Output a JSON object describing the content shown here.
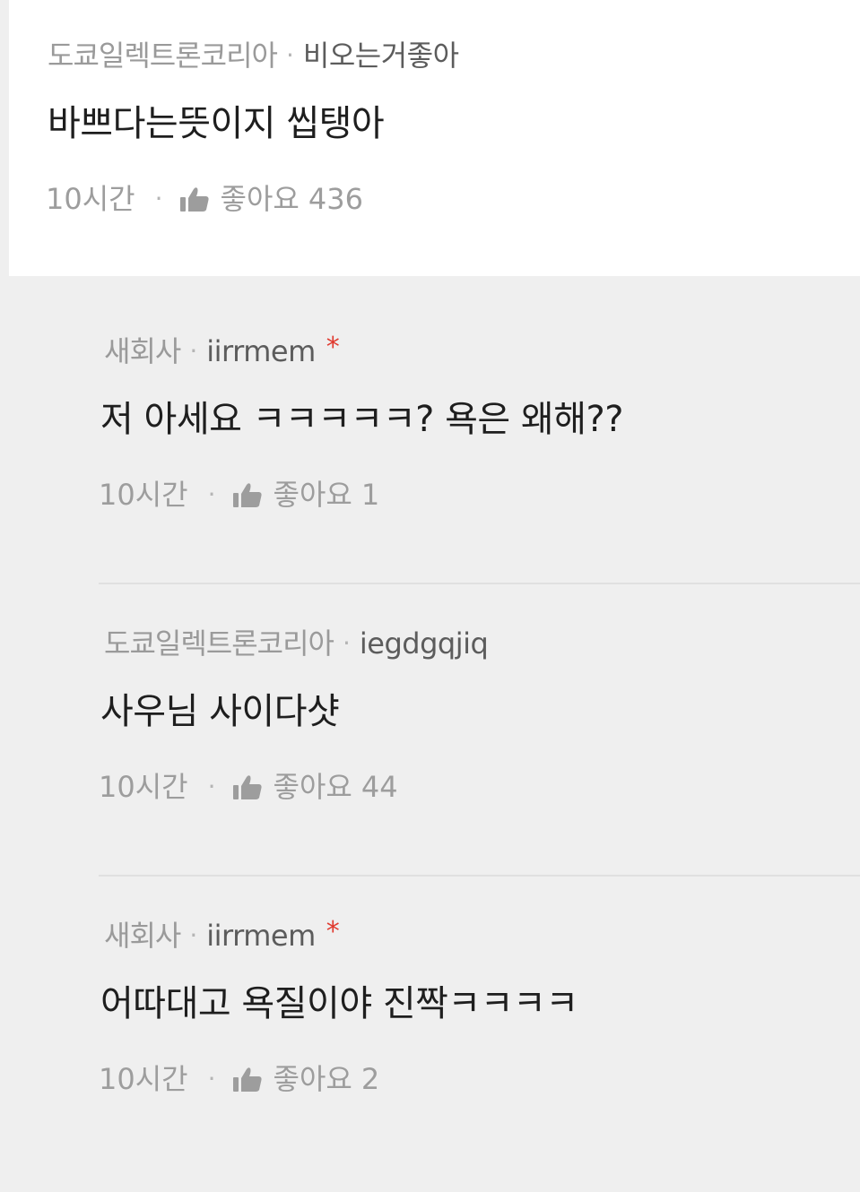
{
  "comments": [
    {
      "author": "도쿄일렉트론코리아",
      "reply_to": "비오는거좋아",
      "mark": "",
      "text": "바쁘다는뜻이지 씹탱아",
      "time": "10시간",
      "like_label": "좋아요",
      "likes": "436"
    },
    {
      "author": "새회사",
      "reply_to": "iirrmem",
      "mark": "*",
      "text": "저 아세요 ㅋㅋㅋㅋㅋ? 욕은 왜해??",
      "time": "10시간",
      "like_label": "좋아요",
      "likes": "1"
    },
    {
      "author": "도쿄일렉트론코리아",
      "reply_to": "iegdgqjiq",
      "mark": "",
      "text": "사우님 사이다샷",
      "time": "10시간",
      "like_label": "좋아요",
      "likes": "44"
    },
    {
      "author": "새회사",
      "reply_to": "iirrmem",
      "mark": "*",
      "text": "어따대고 욕질이야 진짝ㅋㅋㅋㅋ",
      "time": "10시간",
      "like_label": "좋아요",
      "likes": "2"
    }
  ],
  "separator": "·",
  "icons": {
    "like": "thumbs-up-icon"
  },
  "colors": {
    "parent_background": "#ffffff",
    "reply_background": "#efefef",
    "author": "#9a9a9a",
    "reply_to": "#5c5c5c",
    "body": "#1e1e1e",
    "meta": "#9d9d9d",
    "mark": "#e03a2f"
  }
}
